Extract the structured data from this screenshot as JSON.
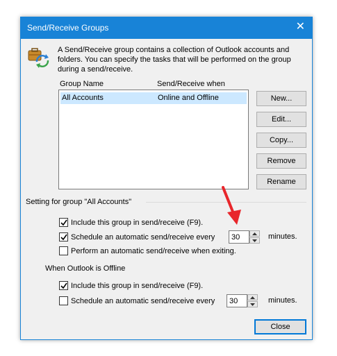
{
  "dialog": {
    "title": "Send/Receive Groups",
    "close_glyph": "✕",
    "description": "A Send/Receive group contains a collection of Outlook accounts and folders. You can specify the tasks that will be performed on the group during a send/receive."
  },
  "list": {
    "columns": [
      "Group Name",
      "Send/Receive when"
    ],
    "rows": [
      {
        "name": "All Accounts",
        "when": "Online and Offline"
      }
    ]
  },
  "buttons": {
    "new": "New...",
    "edit": "Edit...",
    "copy": "Copy...",
    "remove": "Remove",
    "rename": "Rename",
    "close": "Close"
  },
  "online": {
    "heading": "Setting for group \"All Accounts\"",
    "include": {
      "label": "Include this group in send/receive (F9).",
      "checked": true
    },
    "schedule": {
      "label": "Schedule an automatic send/receive every",
      "checked": true,
      "value": "30",
      "suffix": "minutes."
    },
    "exiting": {
      "label": "Perform an automatic send/receive when exiting.",
      "checked": false
    }
  },
  "offline": {
    "heading": "When Outlook is Offline",
    "include": {
      "label": "Include this group in send/receive (F9).",
      "checked": true
    },
    "schedule": {
      "label": "Schedule an automatic send/receive every",
      "checked": false,
      "value": "30",
      "suffix": "minutes."
    }
  },
  "colors": {
    "titlebar": "#1883d7",
    "selection": "#cce8ff",
    "annotation_arrow": "#e8262b"
  },
  "icons": {
    "groups": "send-receive-groups-icon",
    "close": "close-icon",
    "check": "checkmark-icon",
    "spin_up": "spin-up-arrow-icon",
    "spin_down": "spin-down-arrow-icon"
  }
}
